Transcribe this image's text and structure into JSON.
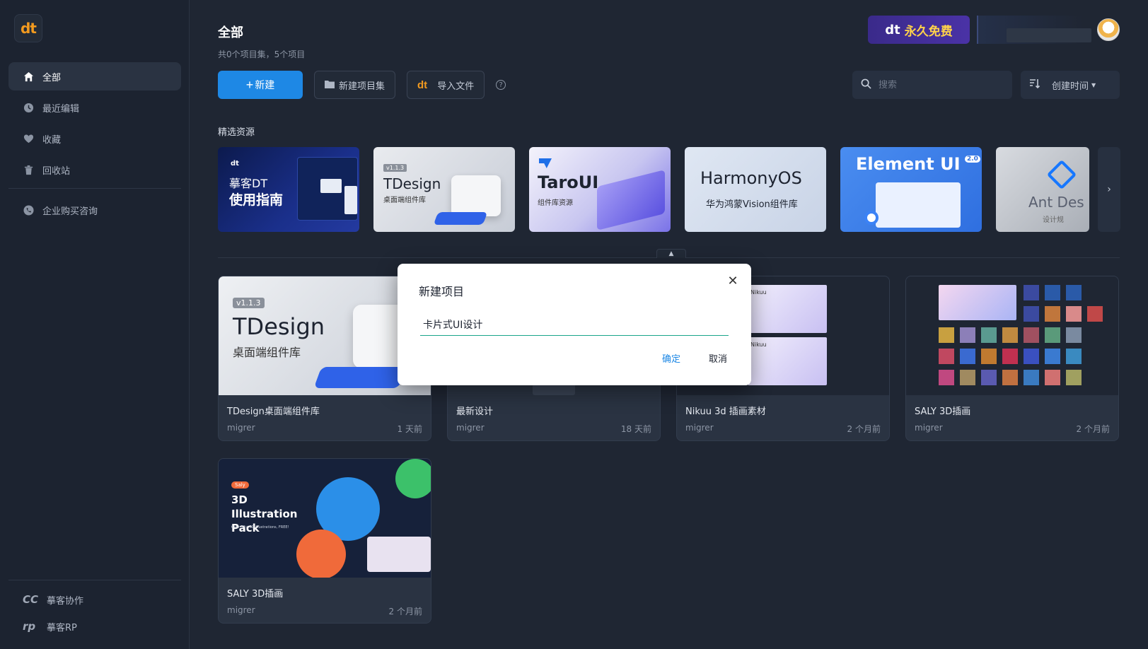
{
  "brand": {
    "logo_text": "dt",
    "accent": "#f29a1f"
  },
  "sidebar": {
    "items": [
      {
        "label": "全部",
        "icon": "home-icon",
        "active": true
      },
      {
        "label": "最近编辑",
        "icon": "clock-icon"
      },
      {
        "label": "收藏",
        "icon": "heart-icon"
      },
      {
        "label": "回收站",
        "icon": "trash-icon"
      }
    ],
    "extra_item": {
      "label": "企业购买咨询",
      "icon": "phone-icon"
    },
    "bottom": [
      {
        "label": "摹客协作",
        "icon_text": "CC"
      },
      {
        "label": "摹客RP",
        "icon_text": "rp"
      }
    ]
  },
  "header": {
    "title": "全部",
    "subtitle": "共0个项目集，5个项目",
    "promo_logo": "dt",
    "promo_text": "永久免费"
  },
  "toolbar": {
    "new_label": "新建",
    "new_set_label": "新建项目集",
    "import_label": "导入文件",
    "import_logo": "dt",
    "help_glyph": "?"
  },
  "search": {
    "placeholder": "搜索"
  },
  "sort": {
    "label": "创建时间"
  },
  "featured": {
    "label": "精选资源",
    "items": [
      {
        "line1": "摹客DT",
        "line2": "使用指南",
        "tag": "dt"
      },
      {
        "title": "TDesign",
        "sub": "桌面端组件库",
        "version": "v1.1.3"
      },
      {
        "title": "TaroUI",
        "sub": "组件库资源"
      },
      {
        "title": "HarmonyOS",
        "sub": "华为鸿蒙Vision组件库"
      },
      {
        "title": "Element UI",
        "badge": "2.0"
      },
      {
        "title": "Ant Des",
        "sub": "设计规"
      }
    ]
  },
  "projects": [
    {
      "title": "TDesign桌面端组件库",
      "owner": "migrer",
      "time": "1 天前",
      "thumb_title": "TDesign",
      "thumb_sub": "桌面端组件库",
      "thumb_version": "v1.1.3"
    },
    {
      "title": "最新设计",
      "owner": "migrer",
      "time": "18 天前"
    },
    {
      "title": "Nikuu 3d 插画素材",
      "owner": "migrer",
      "time": "2 个月前",
      "thumb_label": "Nikuu"
    },
    {
      "title": "SALY 3D插画",
      "owner": "migrer",
      "time": "2 个月前"
    },
    {
      "title": "SALY 3D插画",
      "owner": "migrer",
      "time": "2 个月前",
      "thumb_title": "3D Illustration Pack",
      "thumb_tag": "Saly",
      "thumb_sub": "Over 30+ 3D Illustrations, FREE!"
    }
  ],
  "modal": {
    "title": "新建项目",
    "input_value": "卡片式UI设计",
    "ok_label": "确定",
    "cancel_label": "取消"
  }
}
